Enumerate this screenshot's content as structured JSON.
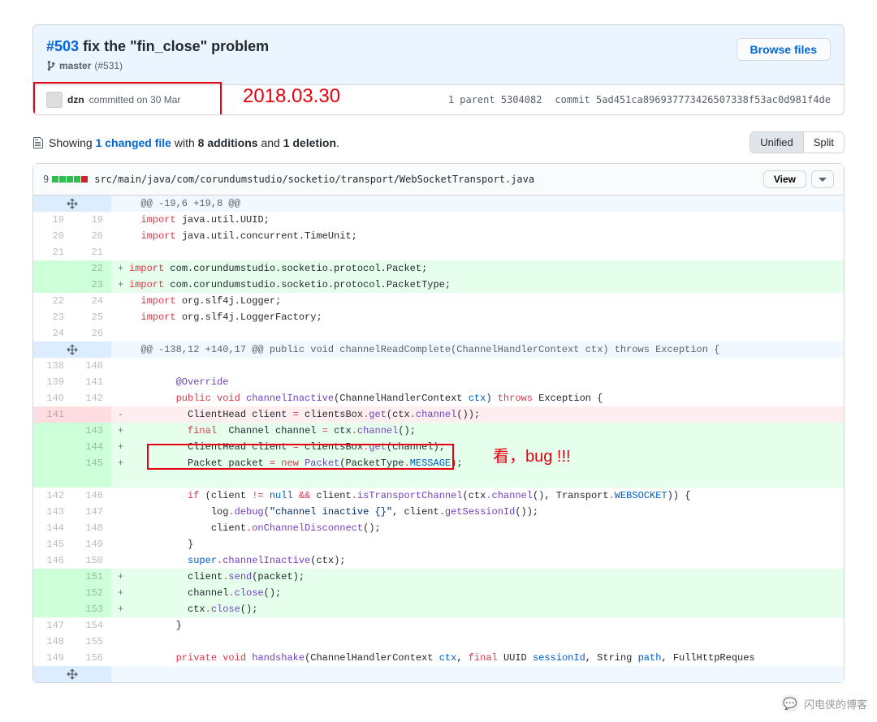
{
  "header": {
    "issue_ref": "#503",
    "commit_title": "fix the \"fin_close\" problem",
    "branch_name": "master",
    "branch_ref": "(#531)",
    "browse_btn": "Browse files"
  },
  "meta": {
    "author": "dzn",
    "committed_text": "committed on 30 Mar",
    "parent_label": "1 parent",
    "parent_sha": "5304082",
    "commit_label": "commit",
    "commit_sha": "5ad451ca896937773426507338f53ac0d981f4de"
  },
  "annotations": {
    "date": "2018.03.30",
    "bug": "看，bug !!!"
  },
  "toolbar": {
    "showing": "Showing",
    "changed_files": "1 changed file",
    "with": "with",
    "additions": "8 additions",
    "and": "and",
    "deletions": "1 deletion",
    "unified": "Unified",
    "split": "Split"
  },
  "file": {
    "diffstat_num": "9",
    "path": "src/main/java/com/corundumstudio/socketio/transport/WebSocketTransport.java",
    "view_btn": "View"
  },
  "diff": {
    "hunk1": "@@ -19,6 +19,8 @@",
    "hunk2": "@@ -138,12 +140,17 @@ public void channelReadComplete(ChannelHandlerContext ctx) throws Exception {",
    "rows": [
      {
        "type": "row",
        "l": "19",
        "r": "19",
        "sign": "",
        "html": "  <span class='k'>import</span> <span class='v'>java.util.UUID</span>;"
      },
      {
        "type": "row",
        "l": "20",
        "r": "20",
        "sign": "",
        "html": "  <span class='k'>import</span> <span class='v'>java.util.concurrent.TimeUnit</span>;"
      },
      {
        "type": "row",
        "l": "21",
        "r": "21",
        "sign": "",
        "html": ""
      },
      {
        "type": "add",
        "l": "",
        "r": "22",
        "sign": "+",
        "html": "<span class='k'>import</span> <span class='v'>com.corundumstudio.socketio.protocol.Packet</span>;"
      },
      {
        "type": "add",
        "l": "",
        "r": "23",
        "sign": "+",
        "html": "<span class='k'>import</span> <span class='v'>com.corundumstudio.socketio.protocol.PacketType</span>;"
      },
      {
        "type": "row",
        "l": "22",
        "r": "24",
        "sign": "",
        "html": "  <span class='k'>import</span> <span class='v'>org.slf4j.Logger</span>;"
      },
      {
        "type": "row",
        "l": "23",
        "r": "25",
        "sign": "",
        "html": "  <span class='k'>import</span> <span class='v'>org.slf4j.LoggerFactory</span>;"
      },
      {
        "type": "row",
        "l": "24",
        "r": "26",
        "sign": "",
        "html": ""
      }
    ],
    "rows2": [
      {
        "type": "row",
        "l": "138",
        "r": "140",
        "sign": "",
        "html": ""
      },
      {
        "type": "row",
        "l": "139",
        "r": "141",
        "sign": "",
        "html": "        <span class='a'>@Override</span>"
      },
      {
        "type": "row",
        "l": "140",
        "r": "142",
        "sign": "",
        "html": "        <span class='k'>public</span> <span class='k'>void</span> <span class='fn'>channelInactive</span>(<span class='v'>ChannelHandlerContext</span> <span class='t'>ctx</span>) <span class='k'>throws</span> <span class='v'>Exception</span> {"
      },
      {
        "type": "del",
        "l": "141",
        "r": "",
        "sign": "-",
        "html": "          <span class='v'>ClientHead</span> client <span class='k'>=</span> clientsBox<span class='k'>.</span><span class='fn'>get</span>(ctx<span class='k'>.</span><span class='fn'>channel</span>());"
      },
      {
        "type": "add",
        "l": "",
        "r": "143",
        "sign": "+",
        "html": "          <span class='k'>final</span>  <span class='v'>Channel</span> channel <span class='k'>=</span> ctx<span class='k'>.</span><span class='fn'>channel</span>();"
      },
      {
        "type": "add",
        "l": "",
        "r": "144",
        "sign": "+",
        "html": "          <span class='v'>ClientHead</span> client <span class='k'>=</span> clientsBox<span class='k'>.</span><span class='fn'>get</span>(channel);"
      },
      {
        "type": "add",
        "l": "",
        "r": "145",
        "sign": "+",
        "html": "          <span class='v'>Packet</span> packet <span class='k'>=</span> <span class='k'>new</span> <span class='fn'>Packet</span>(<span class='v'>PacketType</span><span class='k'>.</span><span class='t'>MESSAGE</span>);"
      },
      {
        "type": "row",
        "l": "142",
        "r": "146",
        "sign": "",
        "html": "          <span class='k'>if</span> (client <span class='k'>!=</span> <span class='t'>null</span> <span class='k'>&amp;&amp;</span> client<span class='k'>.</span><span class='fn'>isTransportChannel</span>(ctx<span class='k'>.</span><span class='fn'>channel</span>(), <span class='v'>Transport</span><span class='k'>.</span><span class='t'>WEBSOCKET</span>)) {"
      },
      {
        "type": "row",
        "l": "143",
        "r": "147",
        "sign": "",
        "html": "              log<span class='k'>.</span><span class='fn'>debug</span>(<span class='s'>\"channel inactive {}\"</span>, client<span class='k'>.</span><span class='fn'>getSessionId</span>());"
      },
      {
        "type": "row",
        "l": "144",
        "r": "148",
        "sign": "",
        "html": "              client<span class='k'>.</span><span class='fn'>onChannelDisconnect</span>();"
      },
      {
        "type": "row",
        "l": "145",
        "r": "149",
        "sign": "",
        "html": "          }"
      },
      {
        "type": "row",
        "l": "146",
        "r": "150",
        "sign": "",
        "html": "          <span class='t'>super</span><span class='k'>.</span><span class='fn'>channelInactive</span>(ctx);"
      },
      {
        "type": "add",
        "l": "",
        "r": "151",
        "sign": "+",
        "html": "          client<span class='k'>.</span><span class='fn'>send</span>(packet);"
      },
      {
        "type": "add",
        "l": "",
        "r": "152",
        "sign": "+",
        "html": "          channel<span class='k'>.</span><span class='fn'>close</span>();"
      },
      {
        "type": "add",
        "l": "",
        "r": "153",
        "sign": "+",
        "html": "          ctx<span class='k'>.</span><span class='fn'>close</span>();"
      },
      {
        "type": "row",
        "l": "147",
        "r": "154",
        "sign": "",
        "html": "        }"
      },
      {
        "type": "row",
        "l": "148",
        "r": "155",
        "sign": "",
        "html": ""
      },
      {
        "type": "row",
        "l": "149",
        "r": "156",
        "sign": "",
        "html": "        <span class='k'>private</span> <span class='k'>void</span> <span class='fn'>handshake</span>(<span class='v'>ChannelHandlerContext</span> <span class='t'>ctx</span>, <span class='k'>final</span> <span class='v'>UUID</span> <span class='t'>sessionId</span>, <span class='v'>String</span> <span class='t'>path</span>, <span class='v'>FullHttpReques</span>"
      }
    ]
  },
  "watermark": "闪电侠的博客"
}
